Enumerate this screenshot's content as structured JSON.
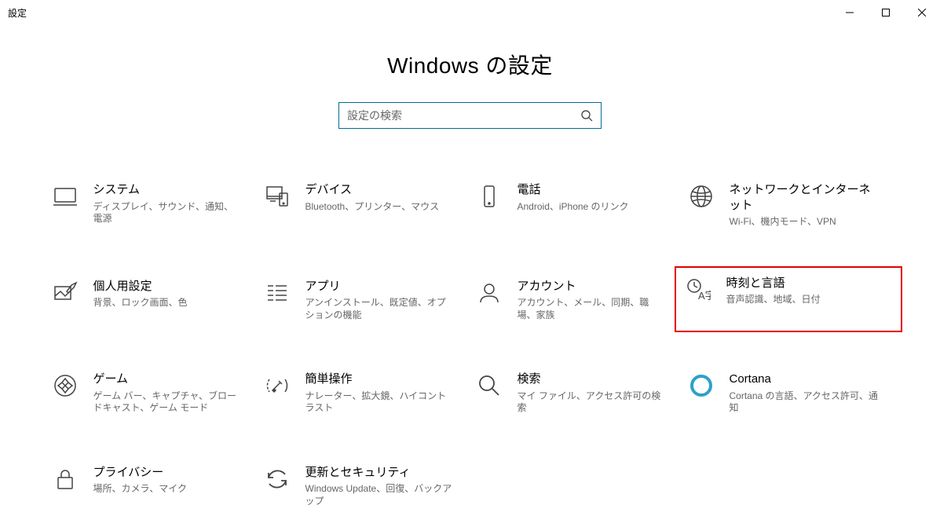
{
  "window_title": "設定",
  "page_title": "Windows の設定",
  "search": {
    "placeholder": "設定の検索"
  },
  "tiles": [
    {
      "title": "システム",
      "desc": "ディスプレイ、サウンド、通知、電源"
    },
    {
      "title": "デバイス",
      "desc": "Bluetooth、プリンター、マウス"
    },
    {
      "title": "電話",
      "desc": "Android、iPhone のリンク"
    },
    {
      "title": "ネットワークとインターネット",
      "desc": "Wi-Fi、機内モード、VPN"
    },
    {
      "title": "個人用設定",
      "desc": "背景、ロック画面、色"
    },
    {
      "title": "アプリ",
      "desc": "アンインストール、既定値、オプションの機能"
    },
    {
      "title": "アカウント",
      "desc": "アカウント、メール、同期、職場、家族"
    },
    {
      "title": "時刻と言語",
      "desc": "音声認識、地域、日付"
    },
    {
      "title": "ゲーム",
      "desc": "ゲーム バー、キャプチャ、ブロードキャスト、ゲーム モード"
    },
    {
      "title": "簡単操作",
      "desc": "ナレーター、拡大鏡、ハイコントラスト"
    },
    {
      "title": "検索",
      "desc": "マイ ファイル、アクセス許可の検索"
    },
    {
      "title": "Cortana",
      "desc": "Cortana の言語、アクセス許可、通知"
    },
    {
      "title": "プライバシー",
      "desc": "場所、カメラ、マイク"
    },
    {
      "title": "更新とセキュリティ",
      "desc": "Windows Update、回復、バックアップ"
    }
  ]
}
